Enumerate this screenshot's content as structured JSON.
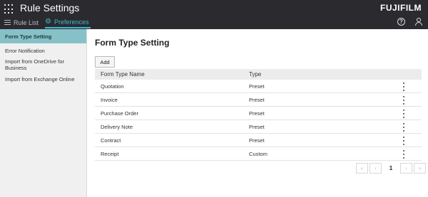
{
  "header": {
    "title": "Rule Settings",
    "brand": "FUJIFILM",
    "tabs": [
      {
        "label": "Rule List",
        "active": false
      },
      {
        "label": "Preferences",
        "active": true
      }
    ],
    "help_label": "?"
  },
  "sidebar": {
    "items": [
      {
        "label": "Form Type Setting",
        "active": true
      },
      {
        "label": "Error Notification",
        "active": false
      },
      {
        "label": "Import from OneDrive for Business",
        "active": false
      },
      {
        "label": "Import from Exchange Online",
        "active": false
      }
    ]
  },
  "main": {
    "title": "Form Type Setting",
    "add_label": "Add",
    "table": {
      "columns": [
        "Form Type Name",
        "Type"
      ],
      "rows": [
        {
          "name": "Quotation",
          "type": "Preset"
        },
        {
          "name": "Invoice",
          "type": "Preset"
        },
        {
          "name": "Purchase Order",
          "type": "Preset"
        },
        {
          "name": "Delivery Note",
          "type": "Preset"
        },
        {
          "name": "Contract",
          "type": "Preset"
        },
        {
          "name": "Receipt",
          "type": "Custom"
        }
      ]
    },
    "pagination": {
      "first": "«",
      "prev": "‹",
      "page": "1",
      "next": "›",
      "last": "»"
    }
  },
  "colors": {
    "header_bg": "#2b2b2f",
    "accent": "#3fb8d0",
    "sidebar_active": "#87c1c8"
  }
}
